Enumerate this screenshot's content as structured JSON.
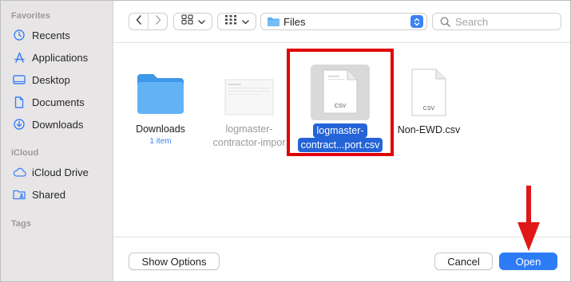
{
  "sidebar": {
    "sections": [
      {
        "title": "Favorites",
        "items": [
          {
            "label": "Recents",
            "icon": "clock-icon"
          },
          {
            "label": "Applications",
            "icon": "applications-icon"
          },
          {
            "label": "Desktop",
            "icon": "desktop-icon"
          },
          {
            "label": "Documents",
            "icon": "document-icon"
          },
          {
            "label": "Downloads",
            "icon": "download-icon"
          }
        ]
      },
      {
        "title": "iCloud",
        "items": [
          {
            "label": "iCloud Drive",
            "icon": "cloud-icon"
          },
          {
            "label": "Shared",
            "icon": "shared-folder-icon"
          }
        ]
      },
      {
        "title": "Tags",
        "items": []
      }
    ]
  },
  "toolbar": {
    "location": "Files",
    "search_placeholder": "Search"
  },
  "files": [
    {
      "name": "Downloads",
      "subtitle": "1 item",
      "type": "folder",
      "state": "normal"
    },
    {
      "name_line1": "logmaster-",
      "name_line2": "contractor-impor",
      "type": "csv-thumbnail",
      "state": "dimmed"
    },
    {
      "name_line1": "logmaster-",
      "name_line2": "contract...port.csv",
      "type": "csv",
      "badge": "CSV",
      "state": "selected"
    },
    {
      "name": "Non-EWD.csv",
      "type": "csv",
      "badge": "CSV",
      "state": "normal"
    }
  ],
  "footer": {
    "show_options": "Show Options",
    "cancel": "Cancel",
    "open": "Open"
  },
  "colors": {
    "accent": "#2d7cf6",
    "selection": "#2463d8",
    "annotation": "#e00000",
    "sidebar_bg": "#e8e5e6"
  }
}
